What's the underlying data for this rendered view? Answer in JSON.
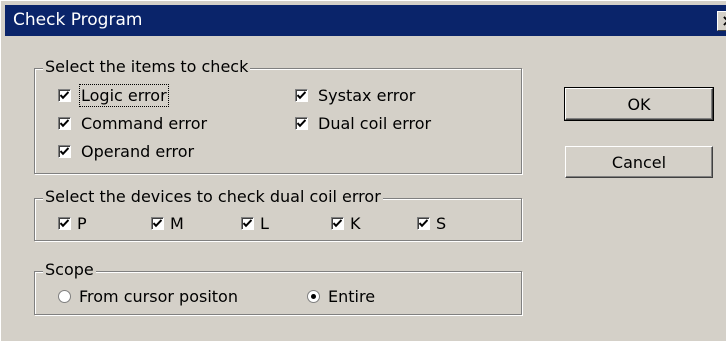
{
  "window": {
    "title": "Check Program",
    "close_glyph": "×"
  },
  "items_group": {
    "legend": "Select the items to check",
    "items": [
      {
        "label": "Logic error",
        "checked": true
      },
      {
        "label": "Systax error",
        "checked": true
      },
      {
        "label": "Command error",
        "checked": true
      },
      {
        "label": "Dual coil error",
        "checked": true
      },
      {
        "label": "Operand error",
        "checked": true
      }
    ]
  },
  "devices_group": {
    "legend": "Select the devices to check dual coil error",
    "devices": [
      {
        "label": "P",
        "checked": true
      },
      {
        "label": "M",
        "checked": true
      },
      {
        "label": "L",
        "checked": true
      },
      {
        "label": "K",
        "checked": true
      },
      {
        "label": "S",
        "checked": true
      }
    ]
  },
  "scope_group": {
    "legend": "Scope",
    "options": [
      {
        "label": "From cursor positon",
        "selected": false
      },
      {
        "label": "Entire",
        "selected": true
      }
    ]
  },
  "buttons": {
    "ok": "OK",
    "cancel": "Cancel"
  }
}
